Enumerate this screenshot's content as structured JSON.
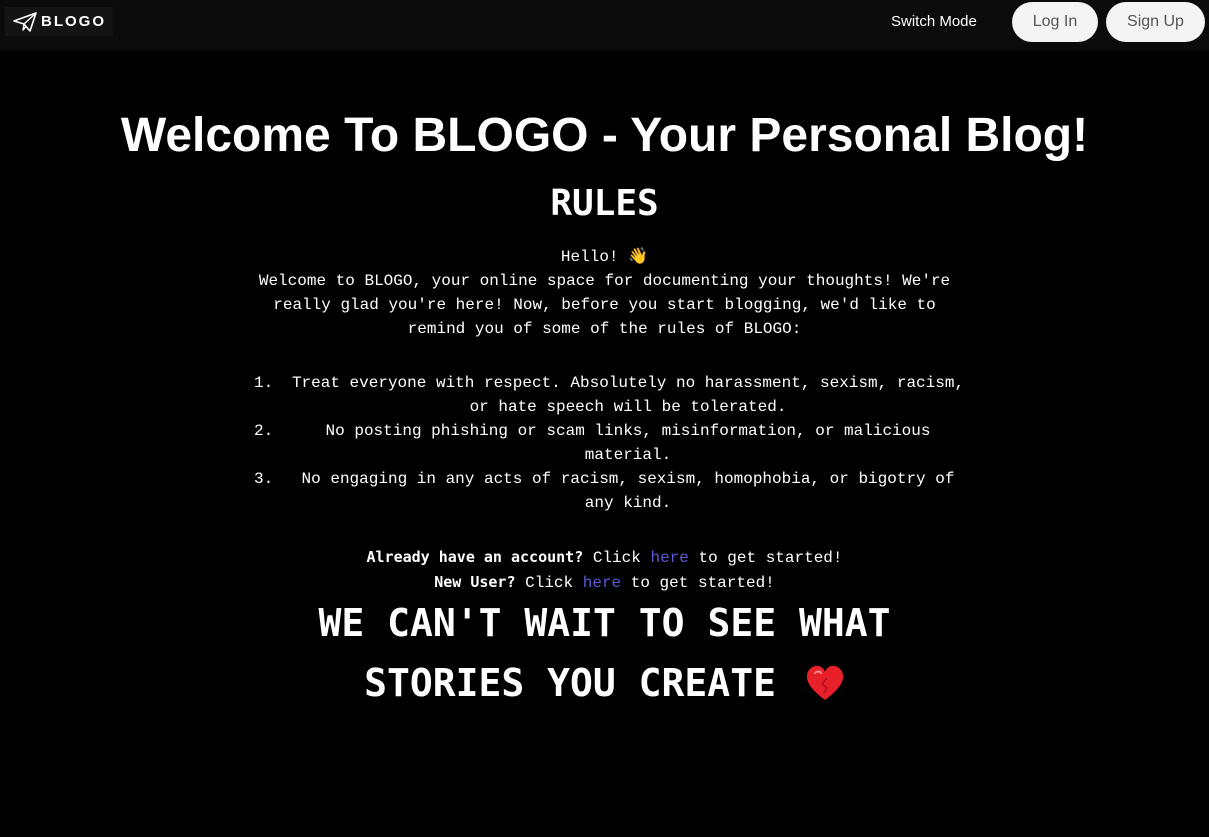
{
  "navbar": {
    "brand_text": "BLOGO",
    "brand_icon": "paper-plane-icon",
    "switch_mode_label": "Switch Mode",
    "login_label": "Log In",
    "signup_label": "Sign Up"
  },
  "main": {
    "title": "Welcome To BLOGO - Your Personal Blog!",
    "rules_heading": "RULES",
    "greeting": "Hello!",
    "greeting_emoji": "👋",
    "intro": "Welcome to BLOGO, your online space for documenting your thoughts! We're really glad you're here! Now, before you start blogging, we'd like to remind you of some of the rules of BLOGO:",
    "rules": [
      {
        "number": "1.",
        "text": "Treat everyone with respect. Absolutely no harassment, sexism, racism, or hate speech will be tolerated."
      },
      {
        "number": "2.",
        "text": "No posting phishing or scam links, misinformation, or malicious material."
      },
      {
        "number": "3.",
        "text": "No engaging in any acts of racism, sexism, homophobia, or bigotry of any kind."
      }
    ],
    "existing_user": {
      "label": "Already have an account?",
      "click": "Click",
      "link": "here",
      "suffix": "to get started!"
    },
    "new_user": {
      "label": "New User?",
      "click": "Click",
      "link": "here",
      "suffix": "to get started!"
    },
    "closing_line1": "WE CAN'T WAIT TO SEE WHAT",
    "closing_line2": "STORIES YOU CREATE",
    "closing_icon": "heart-icon"
  },
  "colors": {
    "background": "#000000",
    "navbar_bg": "#0b0b0b",
    "link": "#5a5ad6",
    "button_bg": "#f4f4f4",
    "button_text": "#555555",
    "heart": "#e8202a"
  }
}
